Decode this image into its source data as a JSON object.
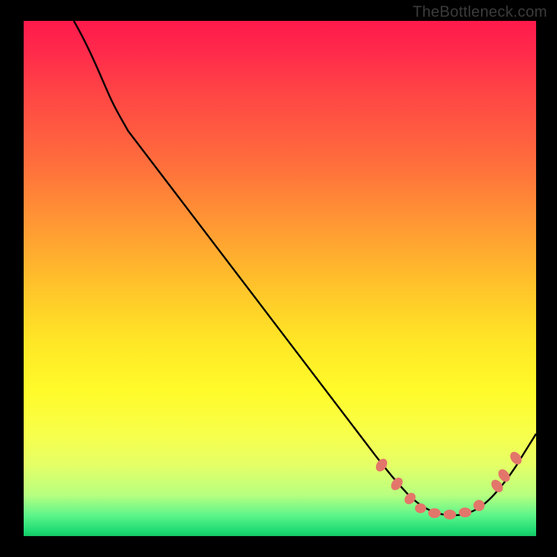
{
  "watermark": "TheBottleneck.com",
  "chart_data": {
    "type": "line",
    "title": "",
    "xlabel": "",
    "ylabel": "",
    "xlim": [
      0,
      100
    ],
    "ylim": [
      0,
      100
    ],
    "series": [
      {
        "name": "bottleneck-curve",
        "x": [
          10,
          14,
          17,
          20,
          30,
          40,
          50,
          60,
          68,
          73,
          77,
          80,
          83,
          86,
          89,
          92,
          95,
          100
        ],
        "y": [
          100,
          92,
          86,
          79,
          66,
          53,
          40,
          27,
          16,
          10,
          6,
          4.5,
          4,
          4.5,
          6,
          9,
          13,
          20
        ]
      }
    ],
    "annotations": [
      {
        "name": "valley-markers",
        "approx_x_range": [
          70,
          96
        ],
        "approx_y_range": [
          4,
          15
        ]
      }
    ],
    "background_gradient": {
      "orientation": "vertical",
      "stops": [
        {
          "pos": 0.0,
          "color": "#ff1a4b"
        },
        {
          "pos": 0.28,
          "color": "#ff6f3c"
        },
        {
          "pos": 0.52,
          "color": "#ffc52a"
        },
        {
          "pos": 0.72,
          "color": "#fffb2a"
        },
        {
          "pos": 0.92,
          "color": "#b8ff80"
        },
        {
          "pos": 1.0,
          "color": "#16c765"
        }
      ]
    }
  }
}
